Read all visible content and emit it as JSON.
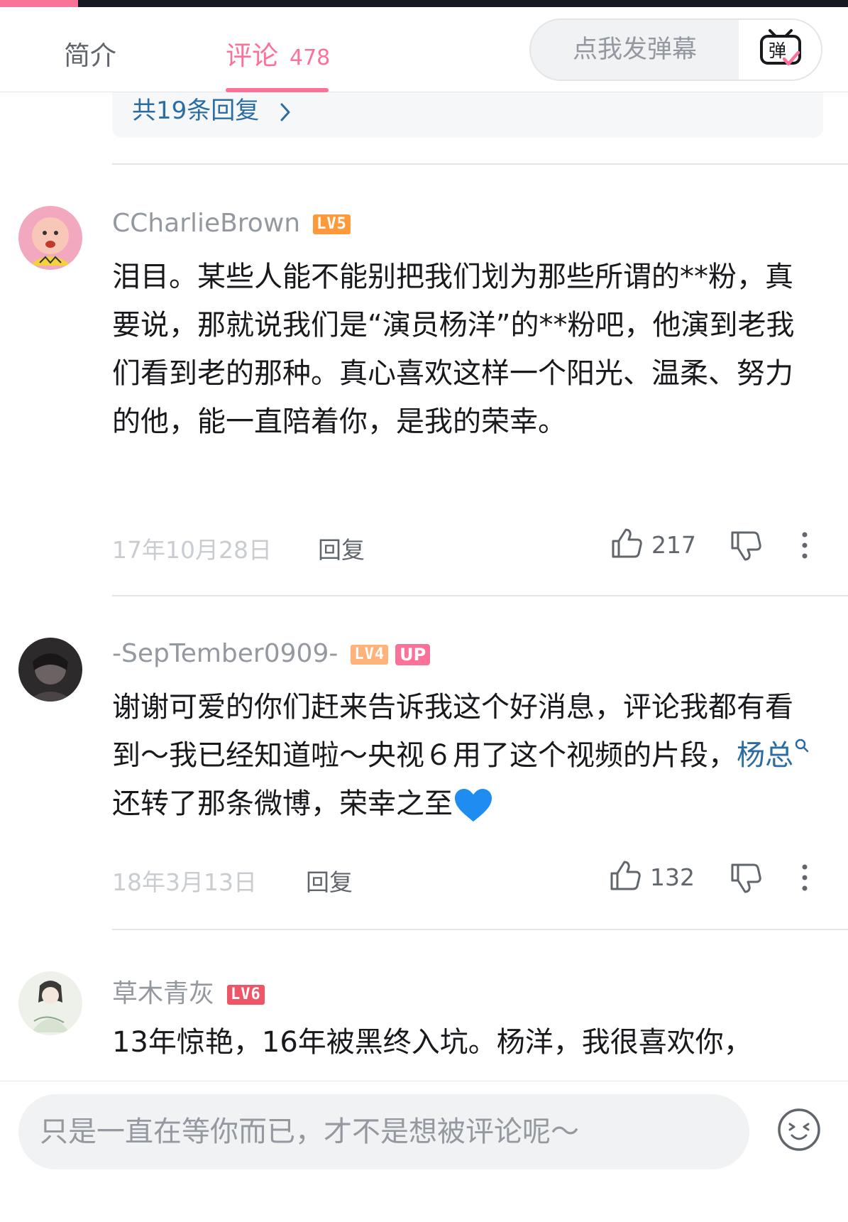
{
  "tabs": {
    "intro_label": "简介",
    "comments_label": "评论",
    "comments_count": "478"
  },
  "danmaku": {
    "placeholder": "点我发弹幕",
    "icon_text": "弹"
  },
  "reply_summary": {
    "label": "共19条回复",
    "icon": "chevron-right-icon"
  },
  "comments": [
    {
      "username": "CCharlieBrown",
      "level": "LV5",
      "text": "泪目。某些人能不能别把我们划为那些所谓的**粉，真要说，那就说我们是“演员杨洋”的**粉吧，他演到老我们看到老的那种。真心喜欢这样一个阳光、温柔、努力的他，能一直陪着你，是我的荣幸。",
      "date": "17年10月28日",
      "reply_label": "回复",
      "likes": "217"
    },
    {
      "username": "-SepTember0909-",
      "level": "LV4",
      "badge": "UP",
      "text_before": "谢谢可爱的你们赶来告诉我这个好消息，评论我都有看到～我已经知道啦～央视６用了这个视频的片段，",
      "link_text": "杨总",
      "text_after": "还转了那条微博，荣幸之至",
      "emoji": "blue-heart-icon",
      "date": "18年3月13日",
      "reply_label": "回复",
      "likes": "132"
    },
    {
      "username": "草木青灰",
      "level": "LV6",
      "text": "13年惊艳，16年被黑终入坑。杨洋，我很喜欢你，"
    }
  ],
  "composer": {
    "placeholder": "只是一直在等你而已，才不是想被评论呢～",
    "emoji_icon": "emoji-icon"
  },
  "colors": {
    "accent": "#fb7299",
    "link": "#2b6ca3",
    "muted_text": "#9499a0",
    "body_text": "#18191c"
  }
}
